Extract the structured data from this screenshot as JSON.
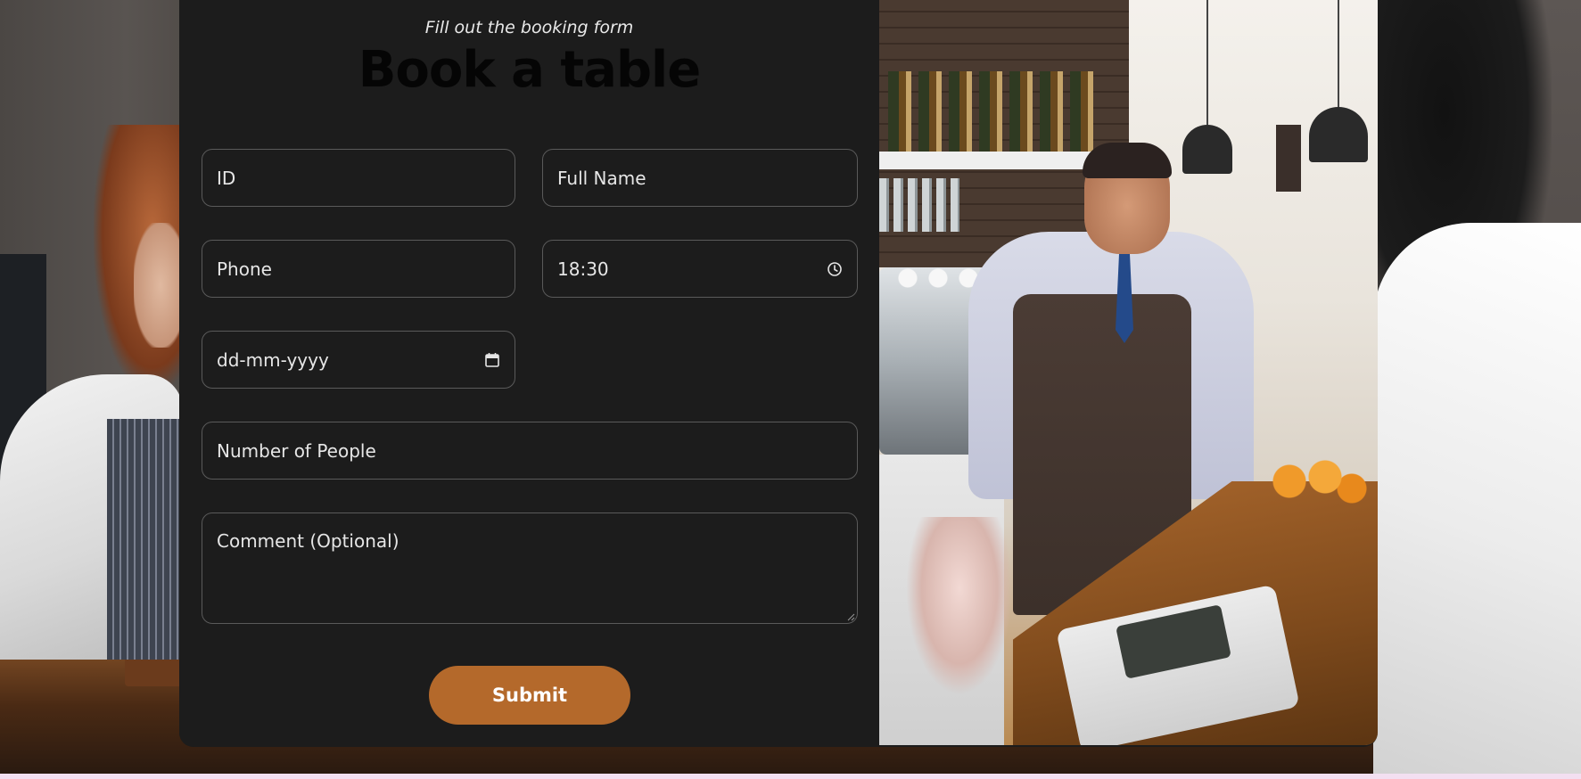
{
  "form": {
    "subtitle": "Fill out the booking form",
    "title": "Book a table",
    "fields": {
      "id": {
        "placeholder": "ID",
        "value": ""
      },
      "full_name": {
        "placeholder": "Full Name",
        "value": ""
      },
      "phone": {
        "placeholder": "Phone",
        "value": ""
      },
      "time": {
        "value": "18:30",
        "icon": "clock-icon"
      },
      "date": {
        "placeholder": "dd-mm-yyyy",
        "value": "",
        "icon": "calendar-icon"
      },
      "people": {
        "placeholder": "Number of People",
        "value": ""
      },
      "comment": {
        "placeholder": "Comment (Optional)",
        "value": ""
      }
    },
    "submit_label": "Submit"
  },
  "colors": {
    "accent": "#b4692b",
    "panel": "#1c1c1c",
    "field_border": "#5a5a5a",
    "text": "#e6e6e6",
    "title": "#050505"
  }
}
